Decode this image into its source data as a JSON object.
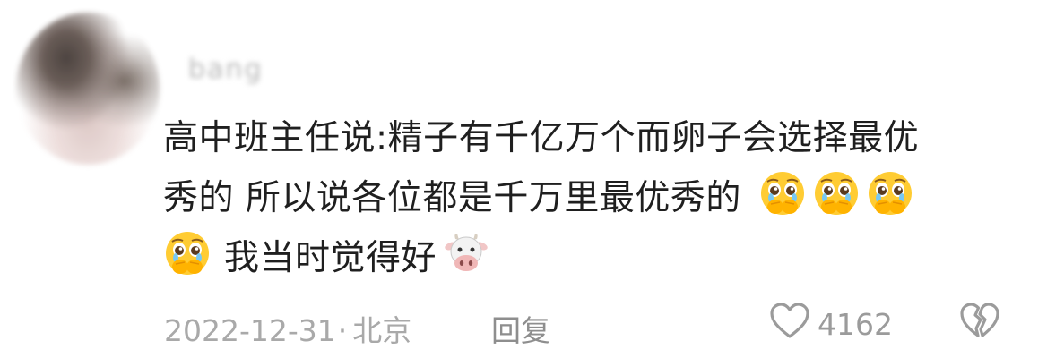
{
  "comment": {
    "author": {
      "name": "bang"
    },
    "text_line1": "高中班主任说:精子有千亿万个而卵子会选择最优",
    "text_line2": "秀的 所以说各位都是千万里最优秀的",
    "text_line3": "我当时觉得好",
    "emojis": [
      "pleading-face-hands-emoji",
      "pleading-face-hands-emoji",
      "pleading-face-hands-emoji",
      "pleading-face-hands-emoji",
      "cow-face-emoji"
    ],
    "date": "2022-12-31",
    "separator": "·",
    "location": "北京",
    "reply_label": "回复",
    "like_count": "4162"
  },
  "colors": {
    "text": "#1f1f1f",
    "meta": "#a9a9a9",
    "icon": "#9b9b9b"
  }
}
